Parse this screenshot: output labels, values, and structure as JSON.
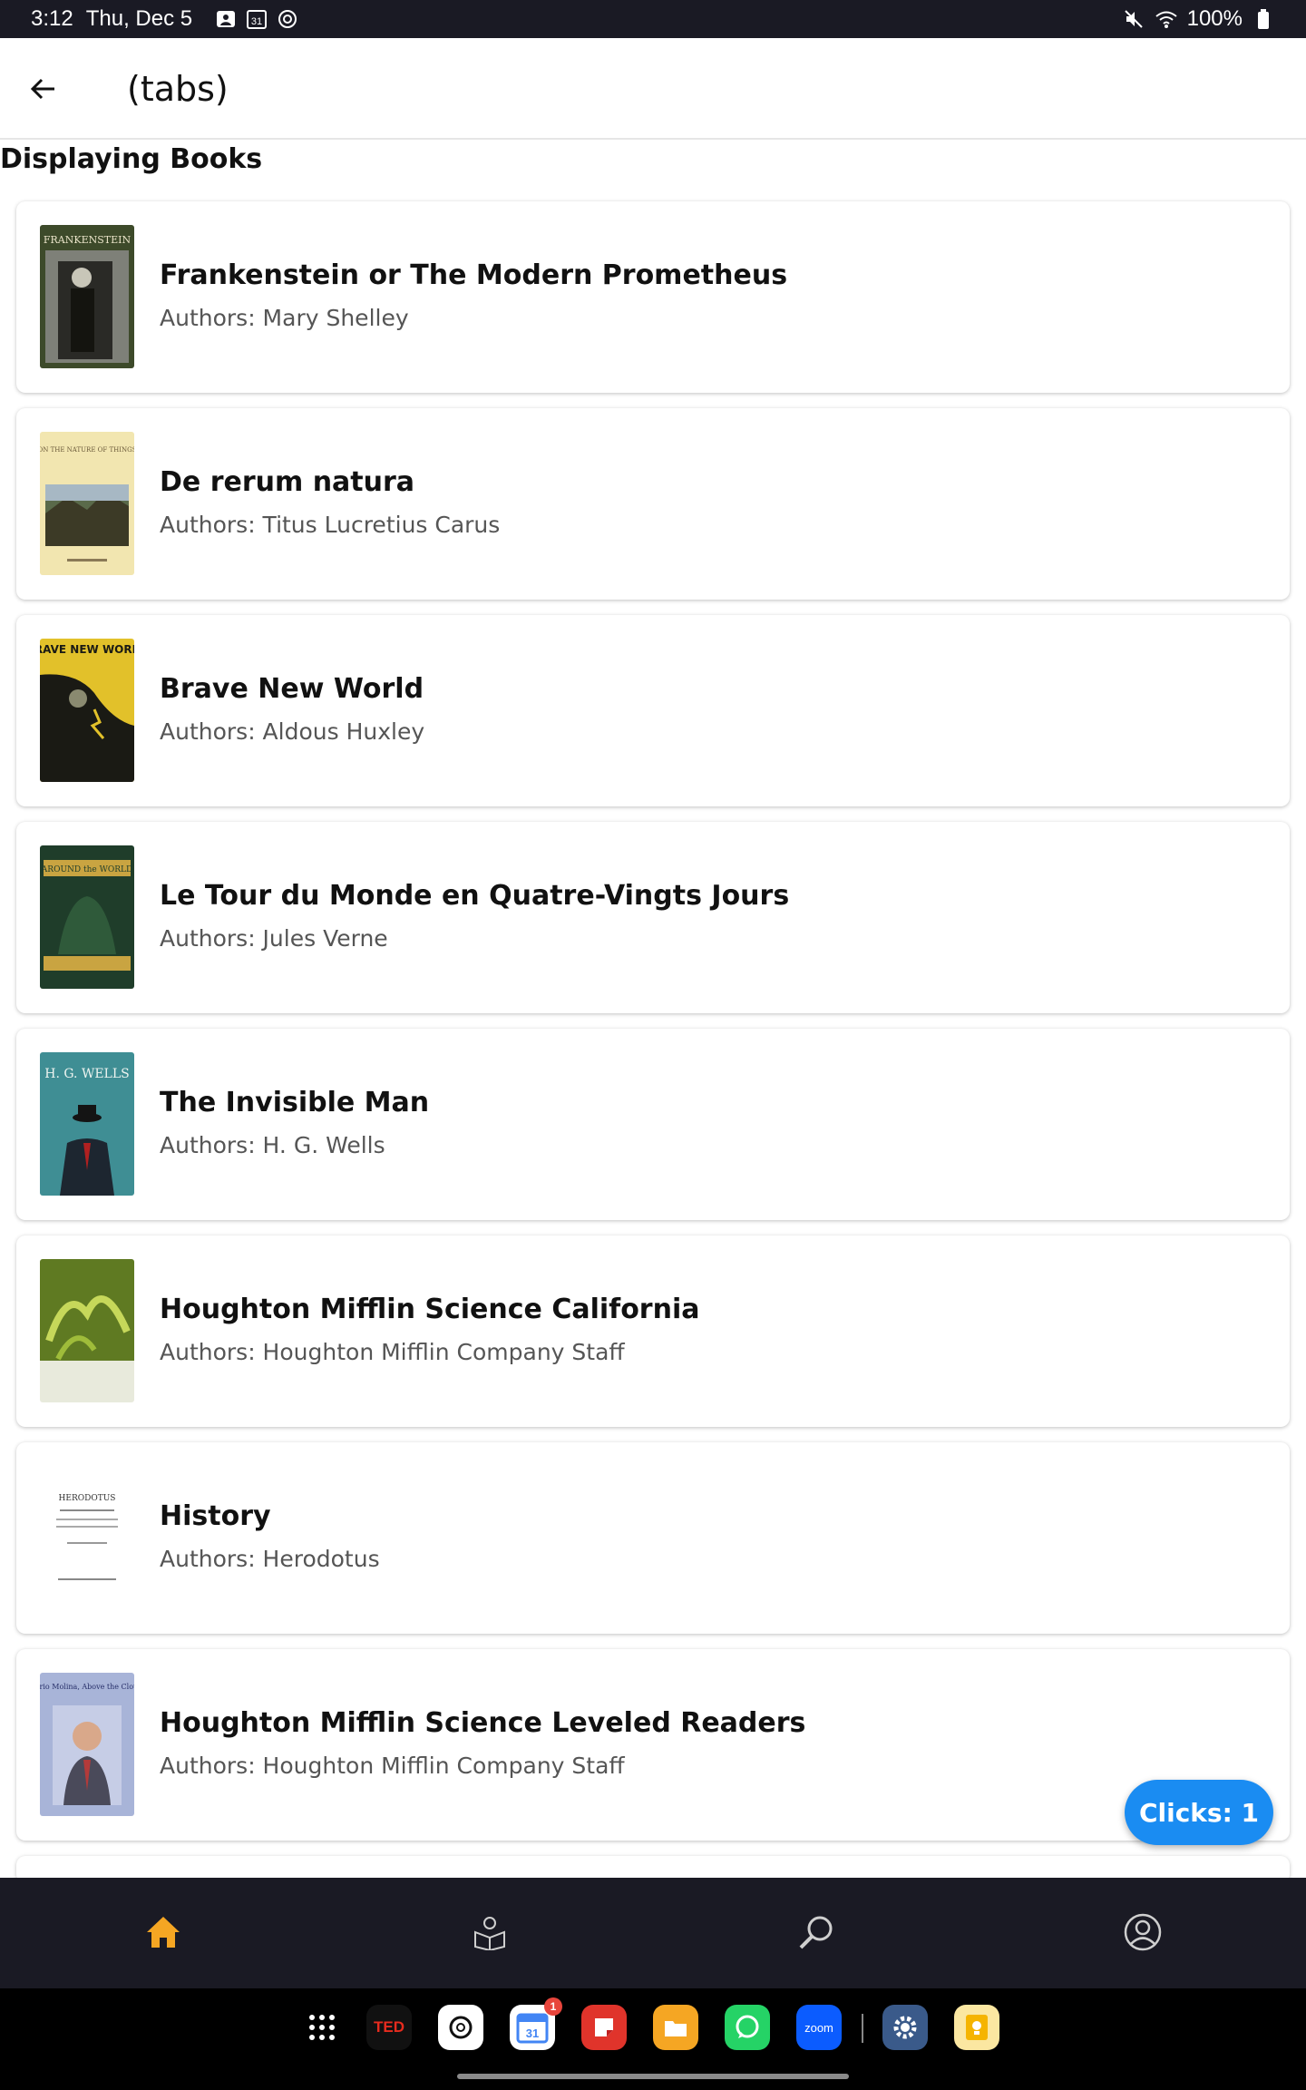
{
  "status_bar": {
    "time": "3:12",
    "date": "Thu, Dec 5",
    "calendar_day": "31",
    "battery": "100%"
  },
  "app_bar": {
    "title": "(tabs)"
  },
  "section": {
    "title": "Displaying Books"
  },
  "books": [
    {
      "title": "Frankenstein or The Modern Prometheus",
      "authors": "Authors: Mary Shelley",
      "cover_label": "FRANKENSTEIN",
      "cover_colors": [
        "#3d4a2a",
        "#8a8a80"
      ]
    },
    {
      "title": "De rerum natura",
      "authors": "Authors: Titus Lucretius Carus",
      "cover_label": "ON THE NATURE OF THINGS",
      "cover_colors": [
        "#f2e6b0",
        "#6b5a3a"
      ]
    },
    {
      "title": "Brave New World",
      "authors": "Authors: Aldous Huxley",
      "cover_label": "BRAVE NEW WORLD",
      "cover_colors": [
        "#e2c12a",
        "#1a1a14"
      ]
    },
    {
      "title": "Le Tour du Monde en Quatre-Vingts Jours",
      "authors": "Authors: Jules Verne",
      "cover_label": "AROUND the WORLD",
      "cover_colors": [
        "#1f3d2a",
        "#c9a441"
      ]
    },
    {
      "title": "The Invisible Man",
      "authors": "Authors: H. G. Wells",
      "cover_label": "H. G. WELLS",
      "cover_colors": [
        "#3f8e94",
        "#1d2630"
      ]
    },
    {
      "title": "Houghton Mifflin Science California",
      "authors": "Authors: Houghton Mifflin Company Staff",
      "cover_label": "",
      "cover_colors": [
        "#5f7a22",
        "#e8eadc"
      ]
    },
    {
      "title": "History",
      "authors": "Authors: Herodotus",
      "cover_label": "HERODOTUS",
      "cover_colors": [
        "#ffffff",
        "#333333"
      ]
    },
    {
      "title": "Houghton Mifflin Science Leveled Readers",
      "authors": "Authors: Houghton Mifflin Company Staff",
      "cover_label": "Mario Molina, Above the Clouds",
      "cover_colors": [
        "#a8b4d8",
        "#3a4a80"
      ]
    }
  ],
  "fab": {
    "label": "Clicks: 1"
  },
  "bottom_nav": {
    "items": [
      {
        "name": "home",
        "icon": "home-icon",
        "active": true
      },
      {
        "name": "library",
        "icon": "reader-book-icon",
        "active": false
      },
      {
        "name": "search",
        "icon": "search-icon",
        "active": false
      },
      {
        "name": "profile",
        "icon": "user-circle-icon",
        "active": false
      }
    ],
    "active_color": "#f5a623",
    "inactive_color": "#cfcfcf"
  },
  "dock": {
    "apps": [
      "apps-grid-icon",
      "TED",
      "chatgpt-icon",
      "calendar-icon",
      "notes-icon",
      "files-icon",
      "whatsapp-icon",
      "zoom",
      "settings-icon",
      "keep-icon"
    ],
    "ted_label": "TED",
    "zoom_label": "zoom",
    "calendar_badge": "1",
    "calendar_day": "31"
  }
}
